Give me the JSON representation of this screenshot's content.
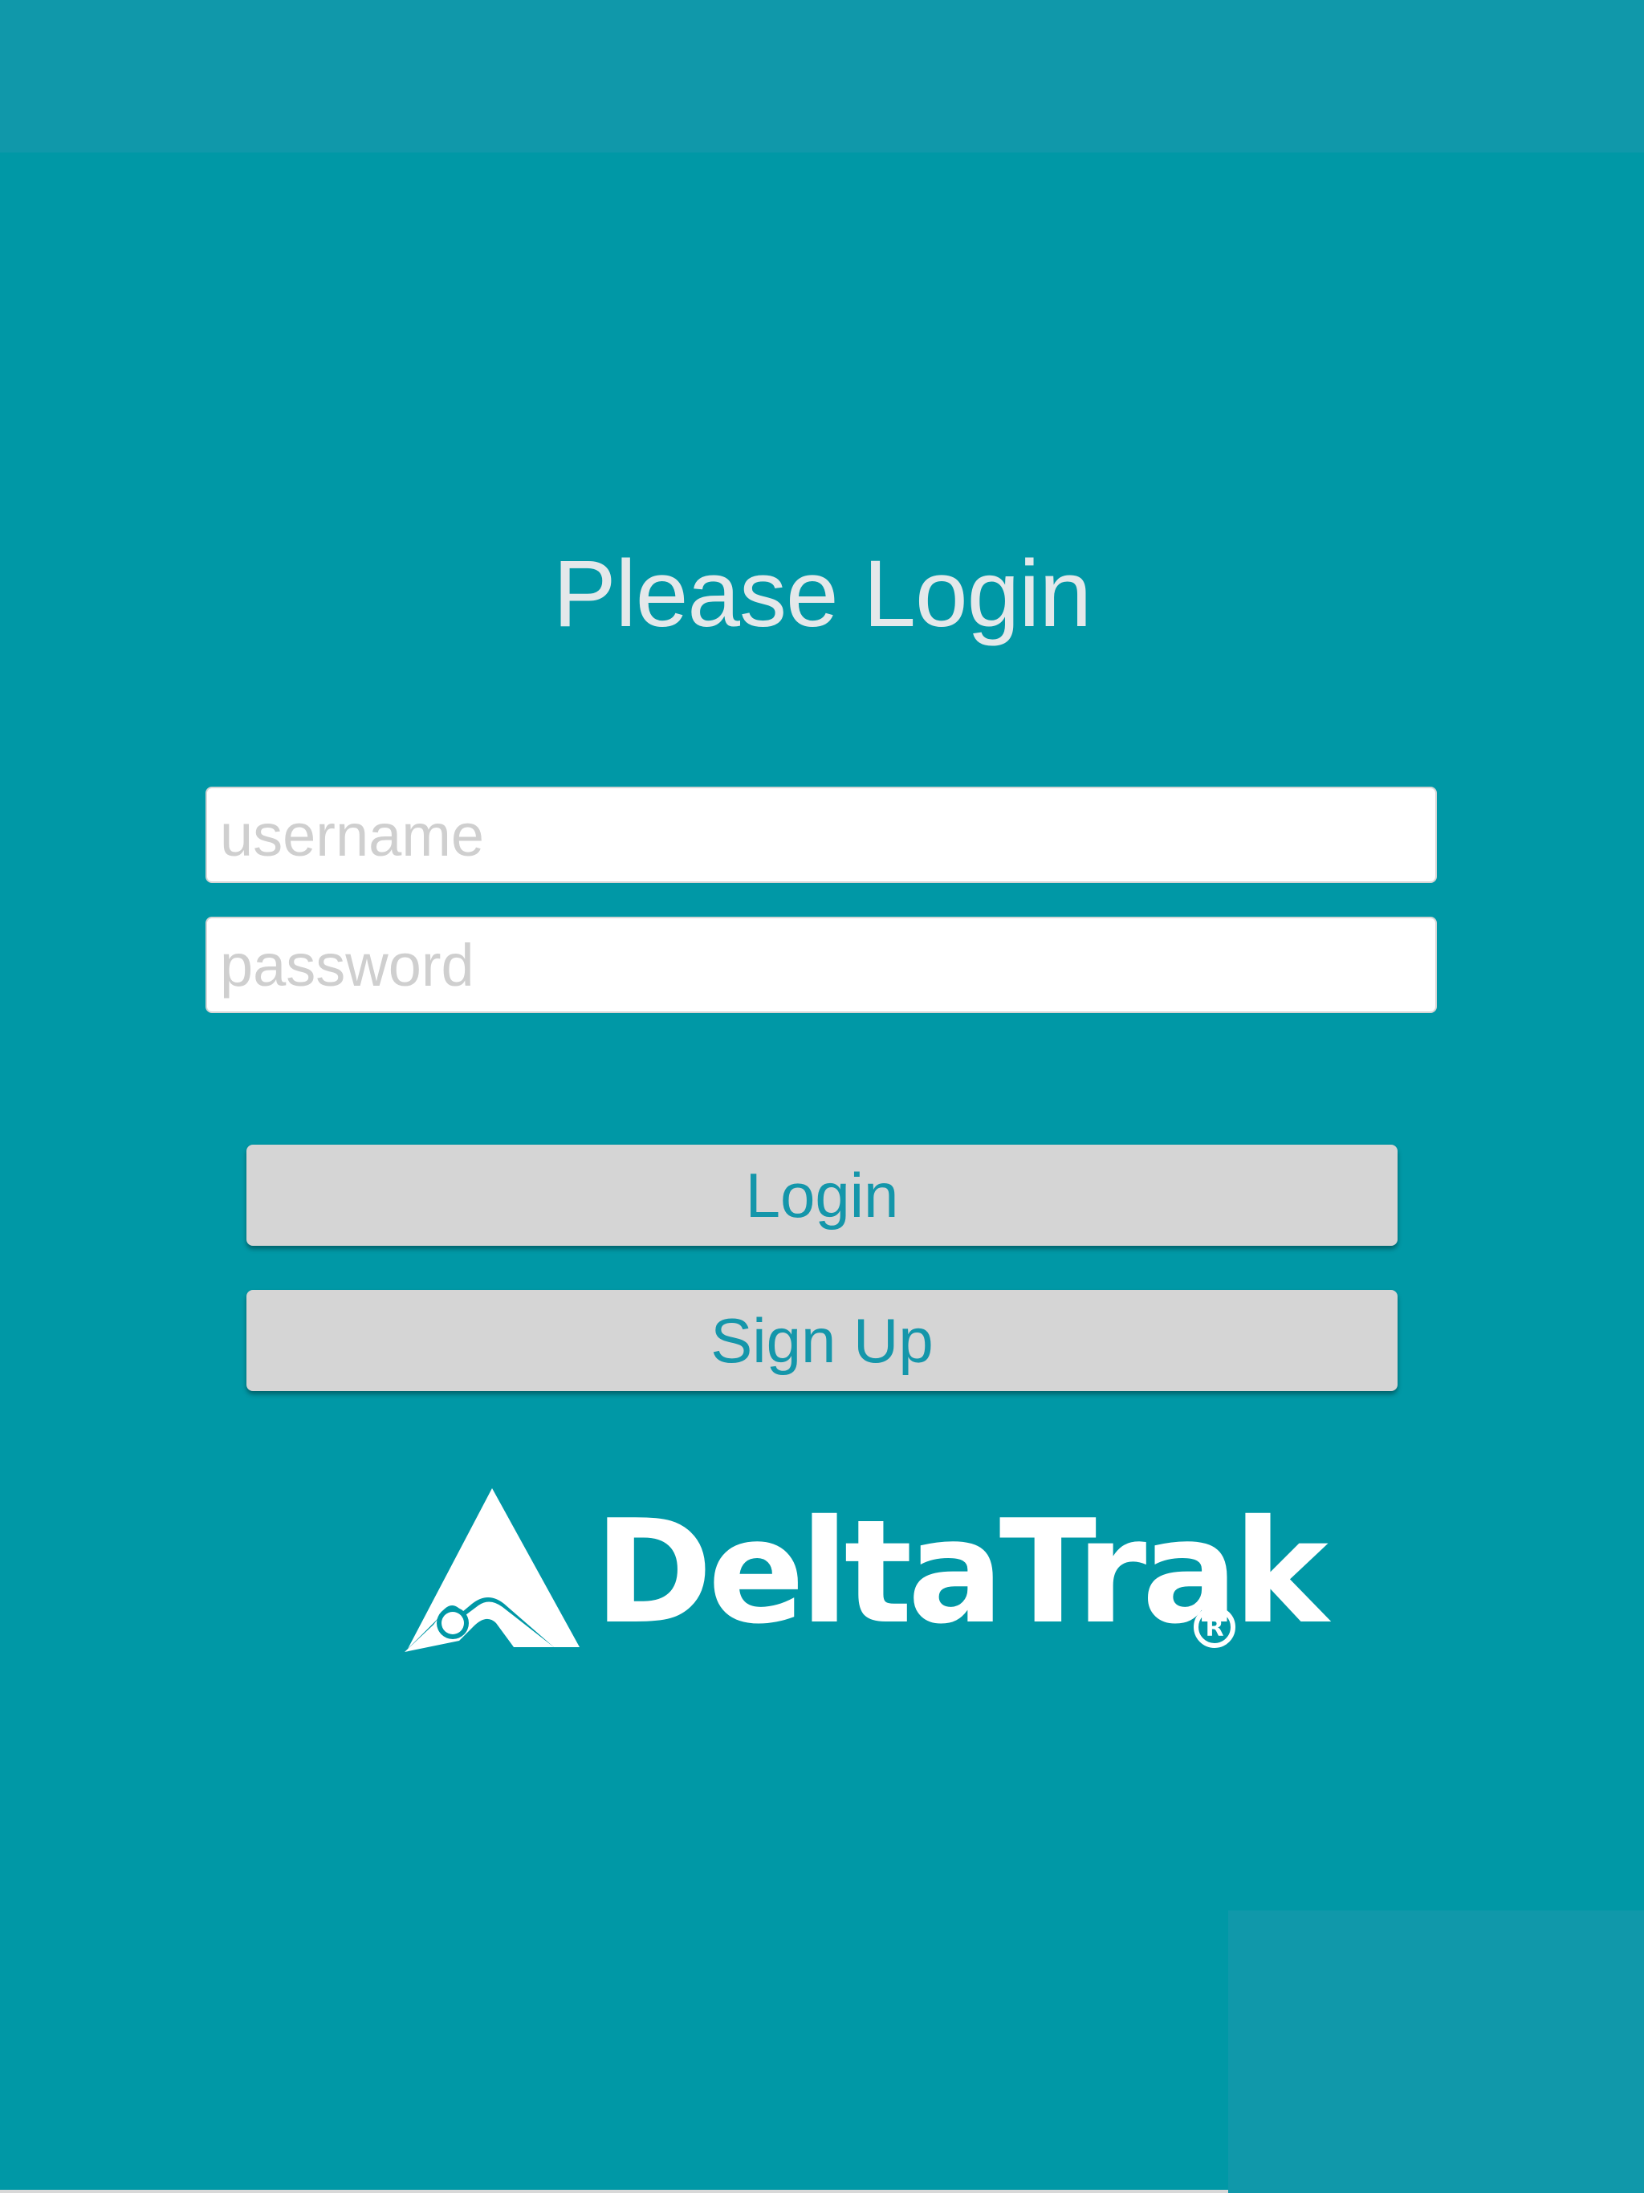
{
  "colors": {
    "background": "#0098a6",
    "top_bar": "#1098aa",
    "button_bg": "#d5d5d5",
    "button_text": "#1496aa",
    "title_text": "#e4e8ea"
  },
  "login_form": {
    "title": "Please Login",
    "username": {
      "placeholder": "username",
      "value": ""
    },
    "password": {
      "placeholder": "password",
      "value": ""
    },
    "login_label": "Login",
    "signup_label": "Sign Up"
  },
  "brand": {
    "name": "DeltaTrak",
    "registered_mark": "®",
    "logo_icon": "delta-triangle-icon"
  }
}
